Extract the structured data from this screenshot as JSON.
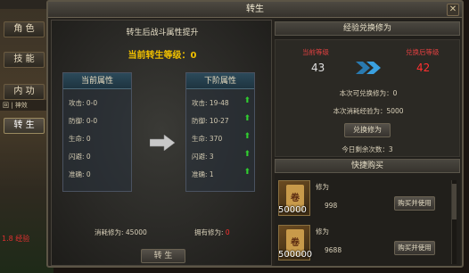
{
  "menu": {
    "items": [
      {
        "label": "角 色"
      },
      {
        "label": "技 能"
      },
      {
        "label": "内 功"
      },
      {
        "label": "转 生"
      }
    ],
    "side_label": "回 | 神效",
    "hp_text": "1.8 经验"
  },
  "window": {
    "title": "转生",
    "close_label": "✕"
  },
  "left_panel": {
    "title": "转生后战斗属性提升",
    "current_level_label": "当前转生等级：0",
    "current_attrs": {
      "header": "当前属性",
      "rows": [
        "攻击: 0-0",
        "防御: 0-0",
        "生命: 0",
        "闪避: 0",
        "准确: 0"
      ]
    },
    "next_attrs": {
      "header": "下阶属性",
      "rows": [
        "攻击: 19-48",
        "防御: 10-27",
        "生命: 370",
        "闪避: 3",
        "准确: 1"
      ]
    },
    "cost_label": "消耗修为: 45000",
    "owned_label": "拥有修为:",
    "owned_value": "0",
    "button_label": "转 生"
  },
  "right_panel": {
    "exchange_header": "经验兑换修为",
    "current_level_label": "当前等级",
    "current_level_value": "43",
    "after_level_label": "兑换后等级",
    "after_level_value": "42",
    "exchangeable_text": "本次可兑换修为：0",
    "exp_cost_text": "本次消耗经验为：5000",
    "exchange_button": "兑换修为",
    "remaining_text": "今日剩余次数：3",
    "quick_buy_header": "快捷购买",
    "items": [
      {
        "amount": "50000",
        "name": "修为",
        "price": "998",
        "button": "购买并使用"
      },
      {
        "amount": "500000",
        "name": "修为",
        "price": "9688",
        "button": "购买并使用"
      }
    ]
  },
  "colors": {
    "accent_gold": "#f0c000",
    "level_red": "#e04040",
    "arrow_green": "#30d030"
  }
}
